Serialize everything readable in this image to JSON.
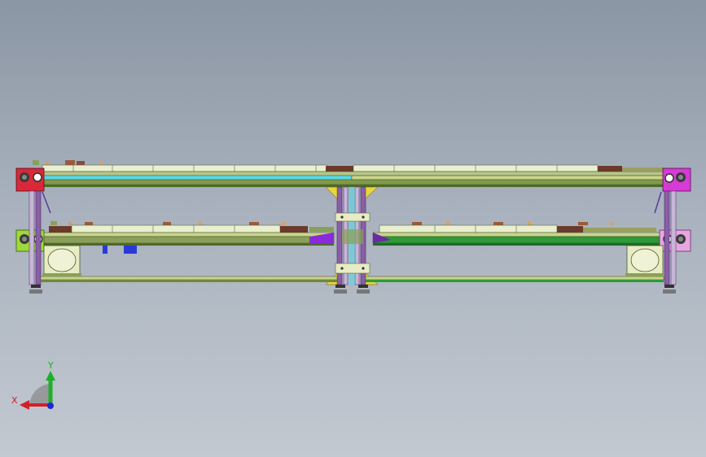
{
  "view": {
    "background_top": "#8b96a4",
    "background_bottom": "#c3c9d1"
  },
  "triad": {
    "x_label": "X",
    "y_label": "Y",
    "x_color": "#d0202a",
    "y_color": "#1fae2a",
    "z_color": "#1a2ad6"
  },
  "colors": {
    "frame_purple": "#8a5fa6",
    "frame_light": "#c8b6d6",
    "rail_green": "#6f8a3a",
    "rail_dark_green": "#2e9a3a",
    "belt_cream": "#e9efcf",
    "belt_brown": "#6b3a2a",
    "cyan": "#5fd6e0",
    "yellow": "#e9d43a",
    "red_block": "#d8283a",
    "magenta_block": "#d83ad6",
    "lime_block": "#9ed83a",
    "pink_block": "#e6a6e0",
    "motor_cream": "#e8ecc4",
    "violet": "#8a2ad8"
  }
}
